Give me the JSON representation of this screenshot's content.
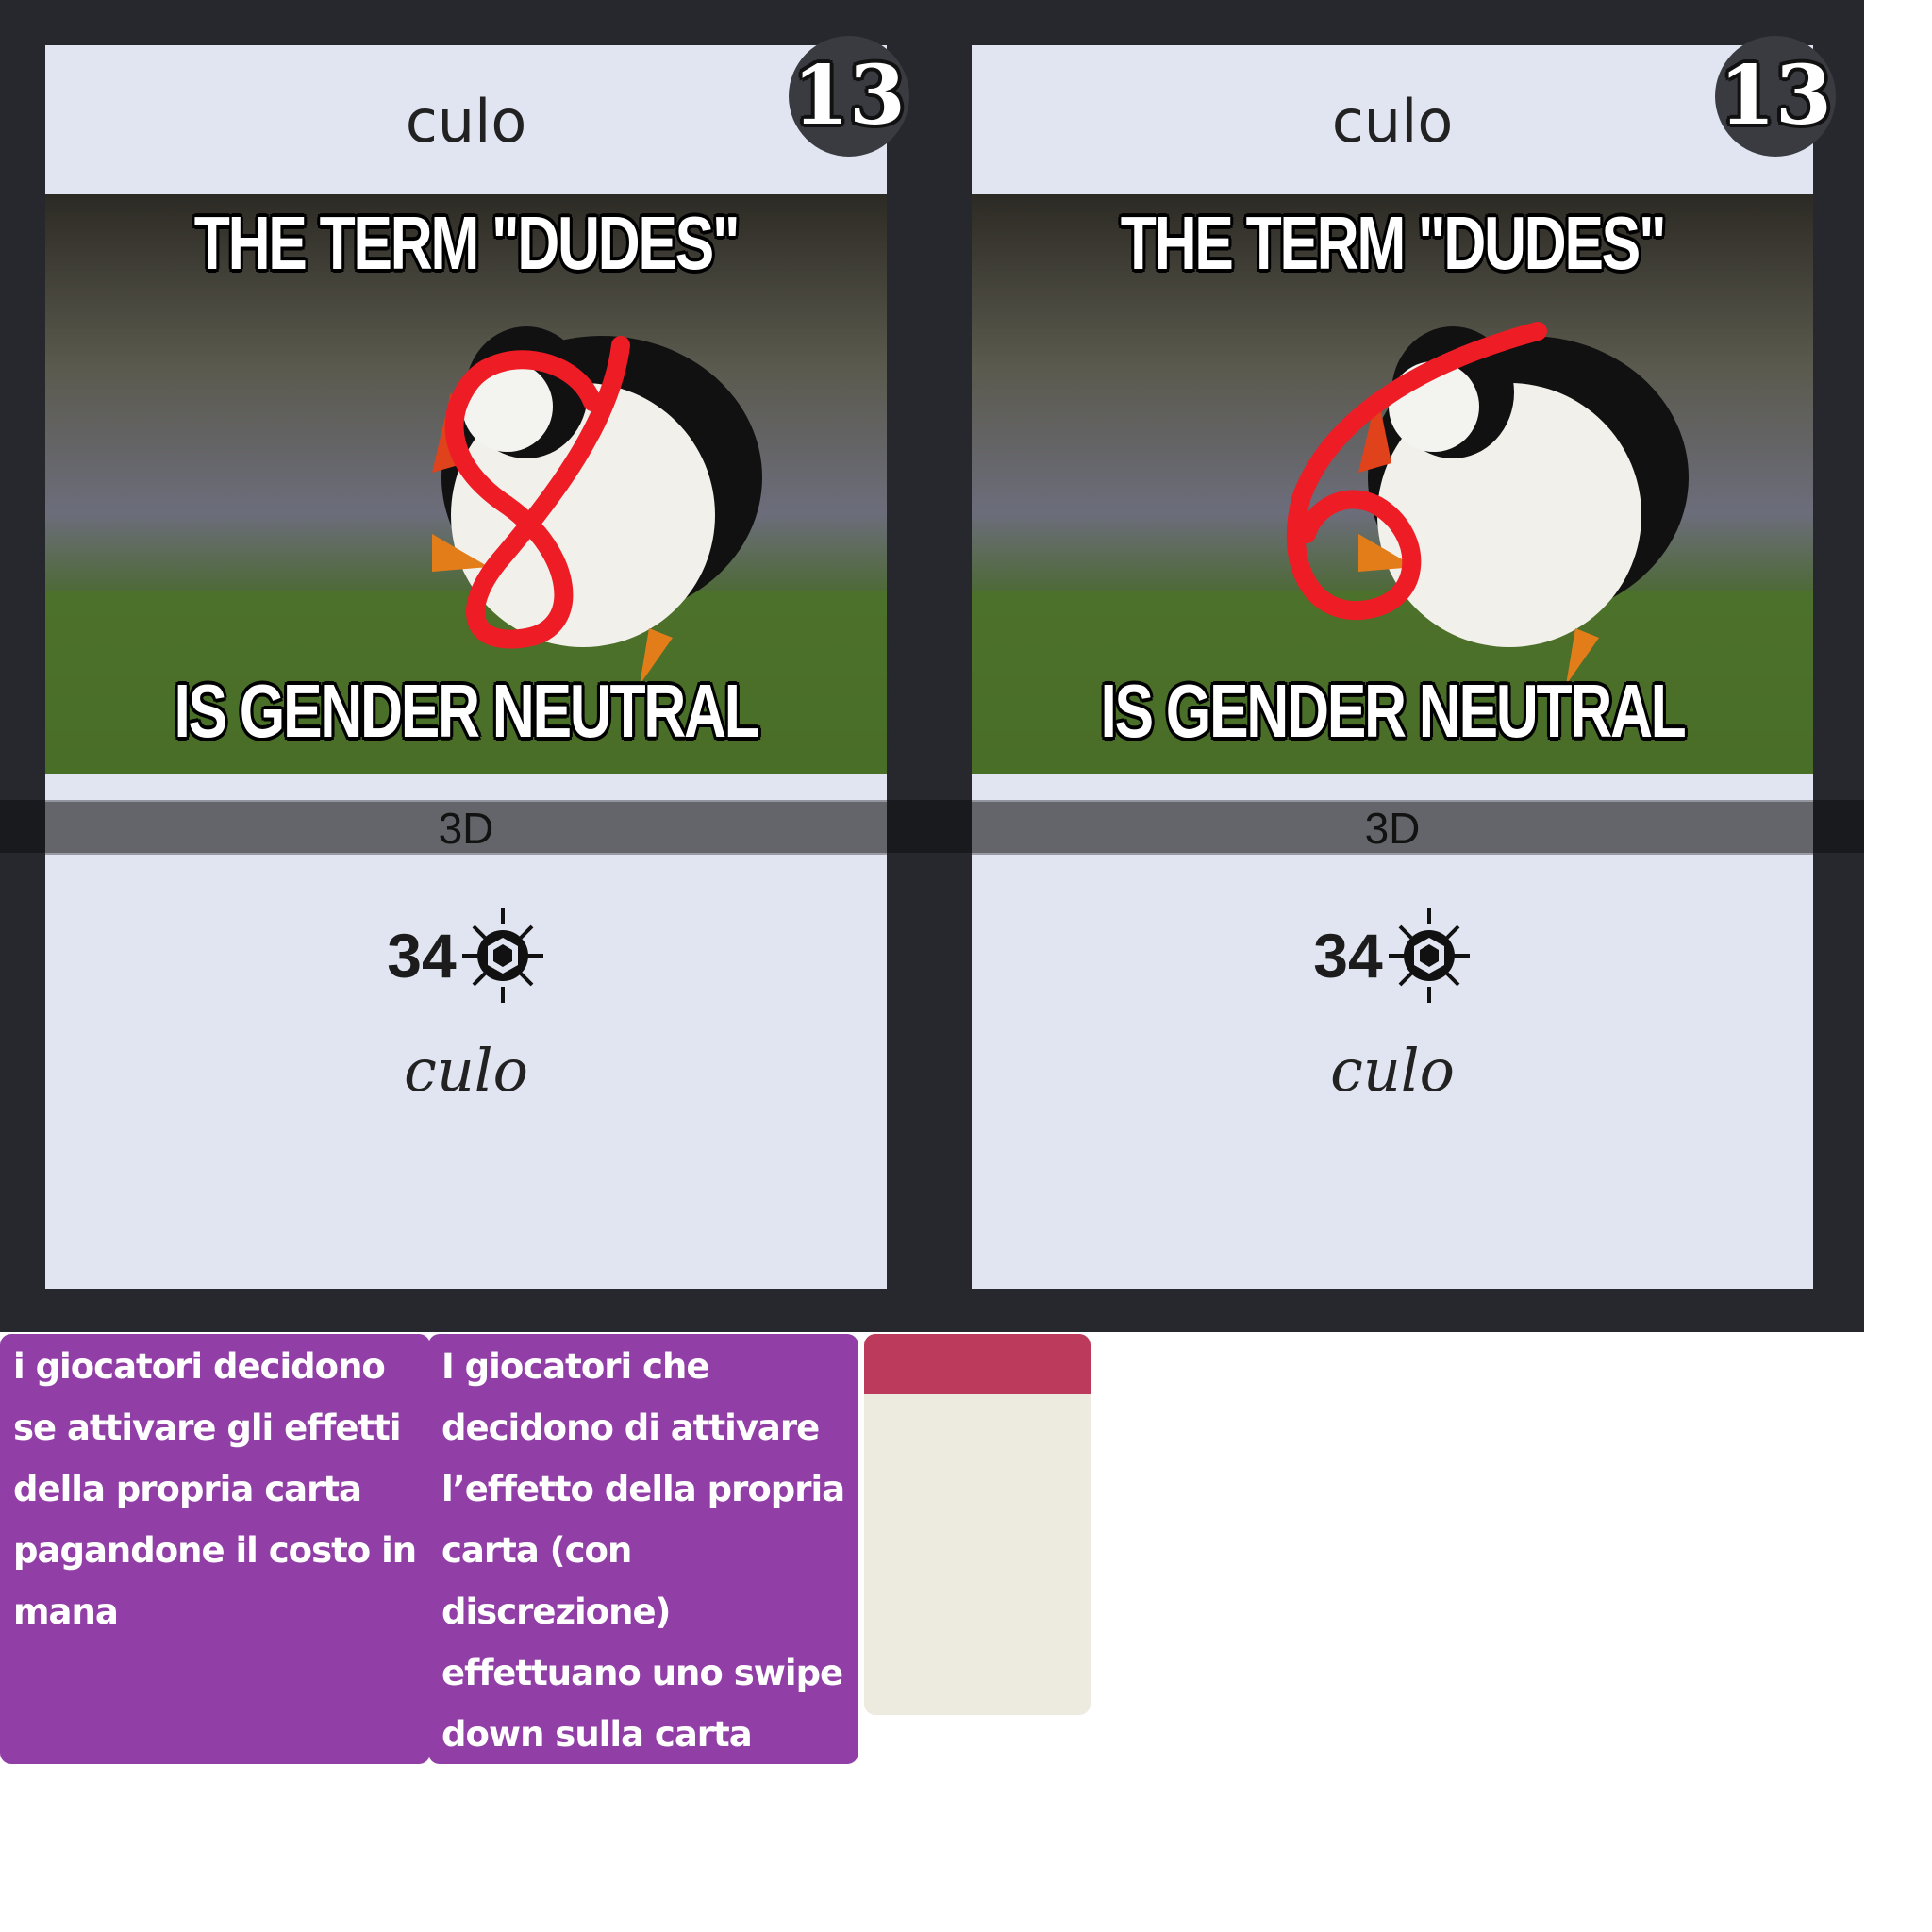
{
  "cards": [
    {
      "title": "culo",
      "cost": "13",
      "meme_top": "THE TERM \"DUDES\"",
      "meme_bottom": "IS GENDER NEUTRAL",
      "type": "3D",
      "stat_value": "34",
      "stat_icon": "sun-hexagon-icon",
      "description": "culo",
      "scribble": "8"
    },
    {
      "title": "culo",
      "cost": "13",
      "meme_top": "THE TERM \"DUDES\"",
      "meme_bottom": "IS GENDER NEUTRAL",
      "type": "3D",
      "stat_value": "34",
      "stat_icon": "sun-hexagon-icon",
      "description": "culo",
      "scribble": "6"
    }
  ],
  "notes": [
    {
      "text": "i giocatori decidono se attivare gli effetti della propria carta pagandone il costo in mana"
    },
    {
      "text": "I giocatori che decidono di attivare l’effetto della propria carta  (con discrezione) effettuano uno swipe down sulla carta"
    }
  ],
  "colors": {
    "panel": "#27282e",
    "card": "#e1e5f1",
    "note": "#913fa6",
    "memo_header": "#bc3a5b",
    "memo_body": "#edebdf",
    "scribble": "#ee1c25"
  }
}
